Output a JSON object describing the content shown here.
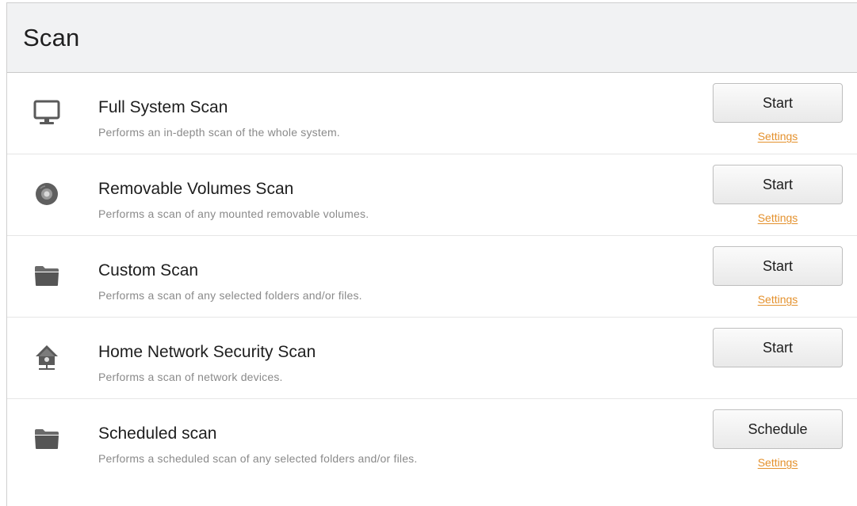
{
  "header": {
    "title": "Scan"
  },
  "scans": [
    {
      "name": "Full System Scan",
      "description": "Performs an in-depth scan of the whole system.",
      "button": "Start",
      "settings": "Settings",
      "icon": "monitor-icon"
    },
    {
      "name": "Removable Volumes Scan",
      "description": "Performs a scan of any mounted removable volumes.",
      "button": "Start",
      "settings": "Settings",
      "icon": "disc-icon"
    },
    {
      "name": "Custom Scan",
      "description": "Performs a scan of any selected folders and/or files.",
      "button": "Start",
      "settings": "Settings",
      "icon": "folder-icon"
    },
    {
      "name": "Home Network Security Scan",
      "description": "Performs a scan of network devices.",
      "button": "Start",
      "settings": null,
      "icon": "home-network-icon"
    },
    {
      "name": "Scheduled scan",
      "description": "Performs a scheduled scan of any selected folders and/or files.",
      "button": "Schedule",
      "settings": "Settings",
      "icon": "folder-icon"
    }
  ],
  "colors": {
    "link": "#e4912d",
    "header_bg": "#f1f2f3",
    "icon": "#5a5a5a"
  }
}
